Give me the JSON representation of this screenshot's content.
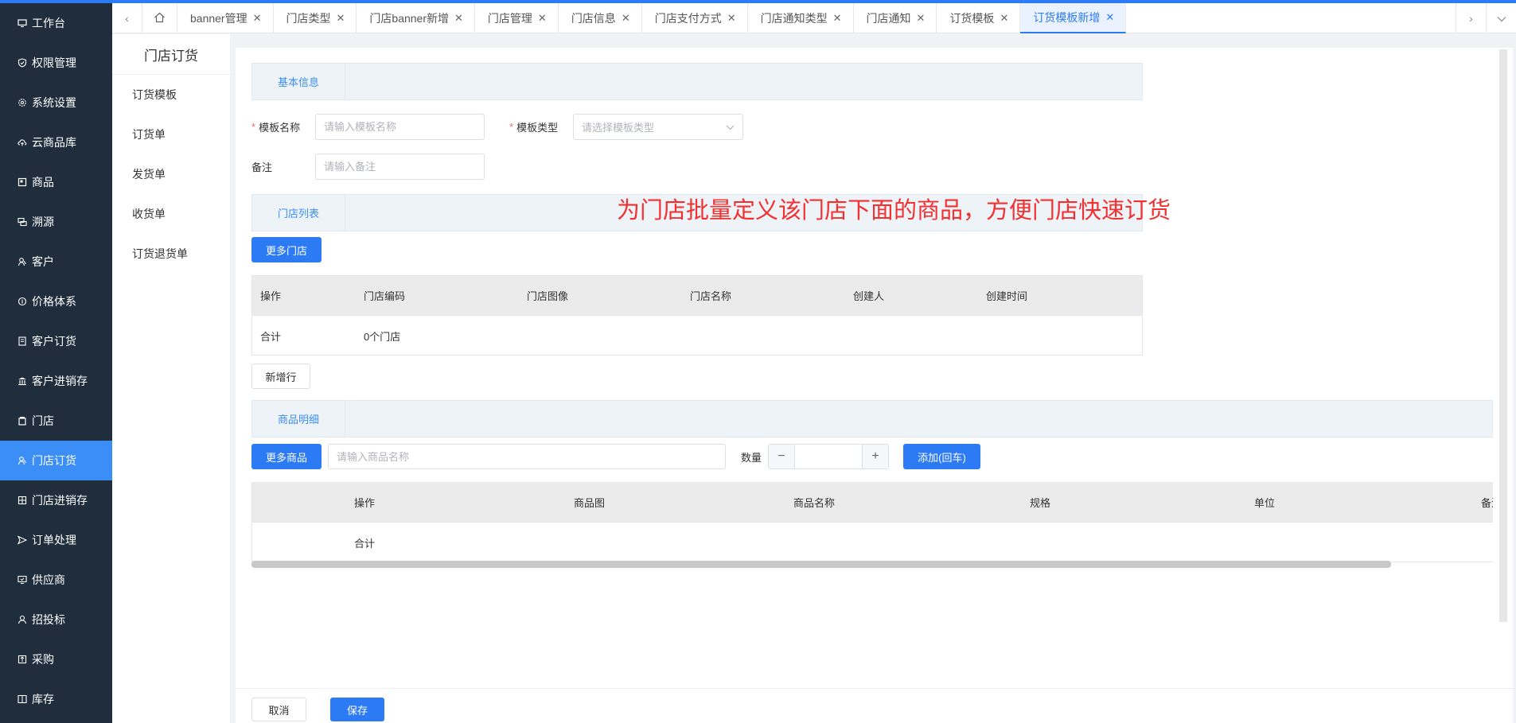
{
  "sidebar": {
    "items": [
      {
        "label": "工作台",
        "icon": "monitor-icon"
      },
      {
        "label": "权限管理",
        "icon": "shield-icon"
      },
      {
        "label": "系统设置",
        "icon": "gear-icon"
      },
      {
        "label": "云商品库",
        "icon": "cloud-icon"
      },
      {
        "label": "商品",
        "icon": "product-icon"
      },
      {
        "label": "溯源",
        "icon": "trace-icon"
      },
      {
        "label": "客户",
        "icon": "customer-icon"
      },
      {
        "label": "价格体系",
        "icon": "price-icon"
      },
      {
        "label": "客户订货",
        "icon": "order-icon"
      },
      {
        "label": "客户进销存",
        "icon": "bank-icon"
      },
      {
        "label": "门店",
        "icon": "store-icon"
      },
      {
        "label": "门店订货",
        "icon": "store-order-icon",
        "active": true
      },
      {
        "label": "门店进销存",
        "icon": "inventory-icon"
      },
      {
        "label": "订单处理",
        "icon": "send-icon"
      },
      {
        "label": "供应商",
        "icon": "supplier-icon"
      },
      {
        "label": "招投标",
        "icon": "bid-icon"
      },
      {
        "label": "采购",
        "icon": "purchase-icon"
      },
      {
        "label": "库存",
        "icon": "stock-icon"
      }
    ]
  },
  "tabs": [
    {
      "label": "banner管理"
    },
    {
      "label": "门店类型"
    },
    {
      "label": "门店banner新增"
    },
    {
      "label": "门店管理"
    },
    {
      "label": "门店信息"
    },
    {
      "label": "门店支付方式"
    },
    {
      "label": "门店通知类型"
    },
    {
      "label": "门店通知"
    },
    {
      "label": "订货模板"
    },
    {
      "label": "订货模板新增",
      "active": true
    }
  ],
  "submenu": {
    "title": "门店订货",
    "items": [
      "订货模板",
      "订货单",
      "发货单",
      "收货单",
      "订货退货单"
    ]
  },
  "form": {
    "basic_section": "基本信息",
    "template_name_label": "模板名称",
    "template_name_placeholder": "请输入模板名称",
    "template_type_label": "模板类型",
    "template_type_placeholder": "请选择模板类型",
    "remark_label": "备注",
    "remark_placeholder": "请输入备注"
  },
  "annotation": "为门店批量定义该门店下面的商品，方便门店快速订货",
  "stores": {
    "section": "门店列表",
    "more_button": "更多门店",
    "columns": [
      "操作",
      "门店编码",
      "门店图像",
      "门店名称",
      "创建人",
      "创建时间"
    ],
    "total_label": "合计",
    "total_value": "0个门店",
    "add_row_button": "新增行"
  },
  "products": {
    "section": "商品明细",
    "more_button": "更多商品",
    "search_placeholder": "请输入商品名称",
    "quantity_label": "数量",
    "minus": "−",
    "plus": "+",
    "add_button": "添加(回车)",
    "columns": [
      "操作",
      "商品图",
      "商品名称",
      "规格",
      "单位",
      "备注"
    ],
    "total_label": "合计"
  },
  "footer": {
    "cancel": "取消",
    "save": "保存"
  },
  "colors": {
    "primary": "#2d7bf4",
    "sidebar_bg": "#1f2d3d",
    "annotation": "#f23030"
  }
}
